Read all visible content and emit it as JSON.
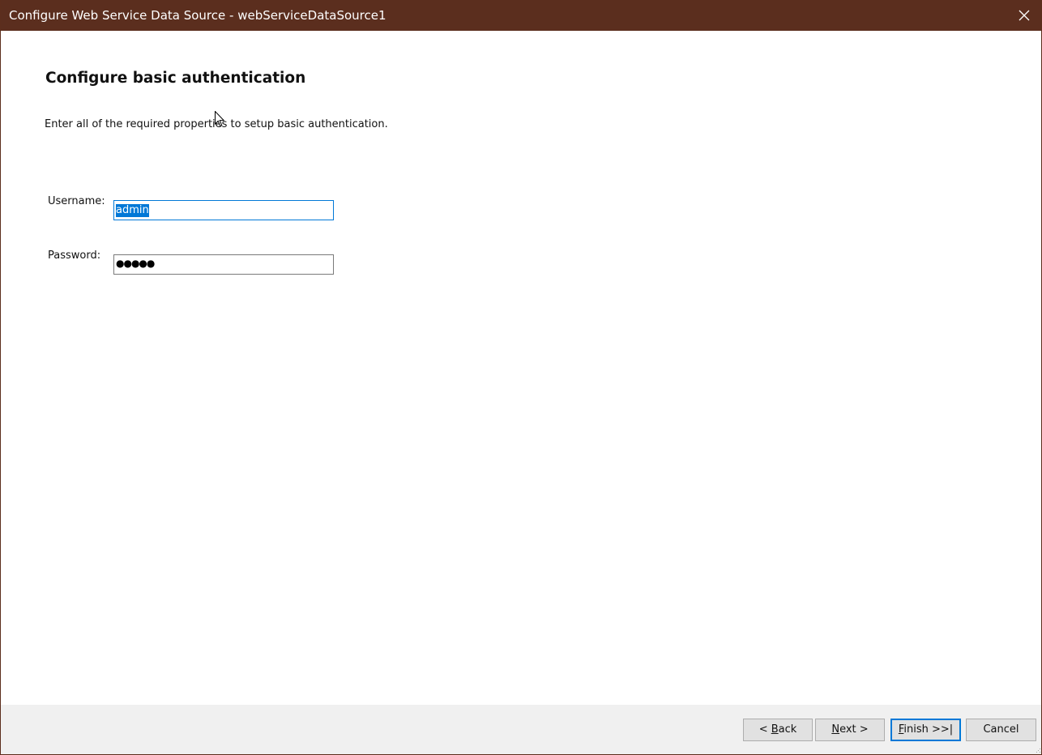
{
  "window": {
    "title": "Configure Web Service Data Source - webServiceDataSource1",
    "close_icon": "close-icon"
  },
  "page": {
    "heading": "Configure basic authentication",
    "description": "Enter all of the required properties to setup basic authentication."
  },
  "form": {
    "username": {
      "label": "Username:",
      "value": "admin"
    },
    "password": {
      "label": "Password:",
      "masked_value": "●●●●●"
    }
  },
  "buttons": {
    "back": {
      "prefix": "< ",
      "mnemonic": "B",
      "rest": "ack"
    },
    "next": {
      "mnemonic": "N",
      "rest": "ext >"
    },
    "finish": {
      "mnemonic": "F",
      "rest": "inish >>|"
    },
    "cancel": "Cancel"
  },
  "colors": {
    "titlebar": "#5b2e1e",
    "accent": "#0078d7",
    "footer": "#f0f0f0"
  }
}
